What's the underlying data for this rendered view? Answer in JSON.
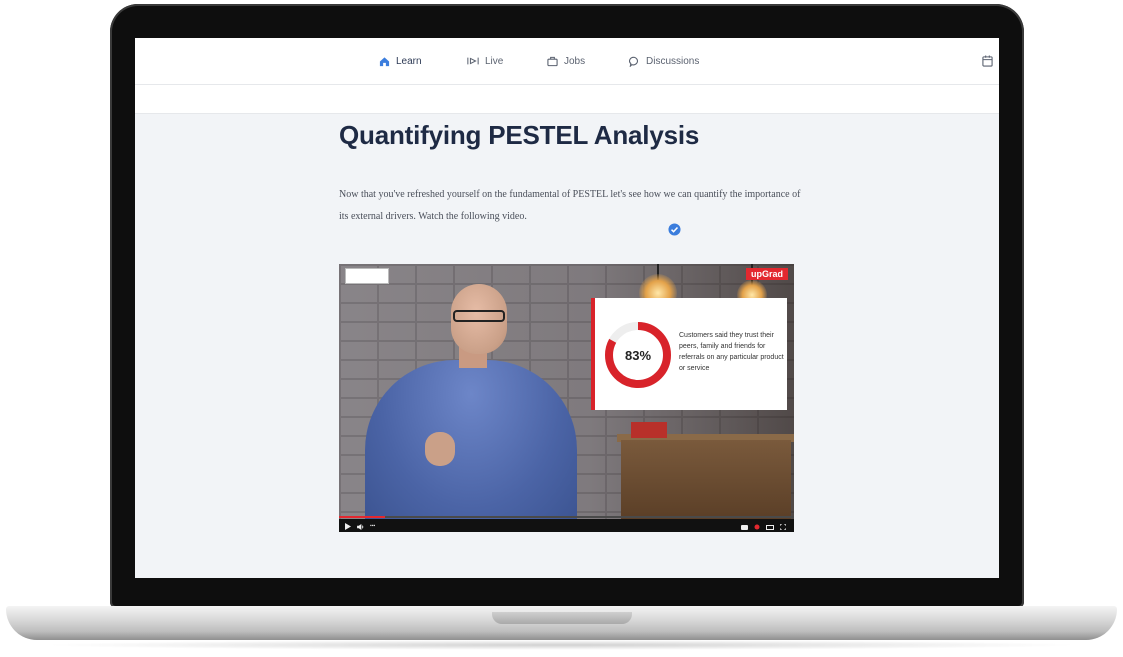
{
  "nav": {
    "items": [
      {
        "label": "Learn",
        "icon": "home-icon",
        "active": true
      },
      {
        "label": "Live",
        "icon": "live-icon",
        "active": false
      },
      {
        "label": "Jobs",
        "icon": "briefcase-icon",
        "active": false
      },
      {
        "label": "Discussions",
        "icon": "chat-bubble-icon",
        "active": false
      }
    ],
    "right_icon": "calendar-icon"
  },
  "page": {
    "title": "Quantifying PESTEL Analysis",
    "intro": "Now that you've refreshed yourself on the fundamental of PESTEL let's see how we can quantify the importance of its external drivers. Watch the following video."
  },
  "video": {
    "brand": "upGrad",
    "card": {
      "percent": 83,
      "percent_label": "83%",
      "text": "Customers said they trust their peers, family and friends for referrals on any particular product or service"
    },
    "progress": 0.1,
    "completed_icon": "check-circle-icon"
  },
  "colors": {
    "accent": "#3b7ddd",
    "brand_red": "#e3282f",
    "title": "#1e2a44"
  }
}
